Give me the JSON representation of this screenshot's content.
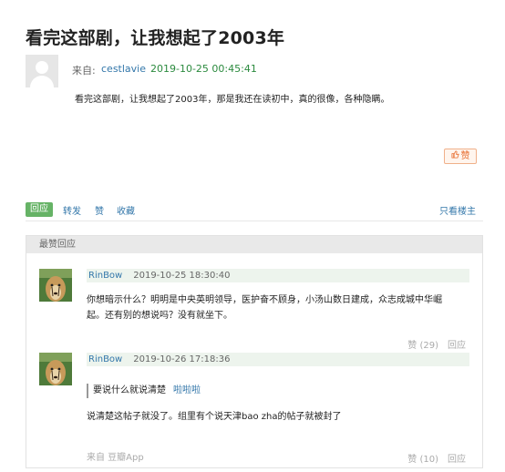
{
  "post": {
    "title": "看完这部剧，让我想起了2003年",
    "from_label": "来自:",
    "author": "cestlavie",
    "time": "2019-10-25 00:45:41",
    "body": "看完这部剧，让我想起了2003年，那是我还在读初中，真的很像，各种隐瞒。",
    "like_label": "赞"
  },
  "actions": {
    "reply": "回应",
    "share": "转发",
    "like": "赞",
    "collect": "收藏",
    "only_op": "只看楼主"
  },
  "comments": {
    "header": "最赞回应",
    "items": [
      {
        "author": "RinBow",
        "time": "2019-10-25 18:30:40",
        "text_line1": "你想暗示什么？明明是中央英明领导，医护奋不顾身，小汤山数日建成，众志成城中华崛",
        "text_line2": "起。还有别的想说吗？没有就坐下。",
        "likes": "赞 (29)",
        "reply": "回应"
      },
      {
        "author": "RinBow",
        "time": "2019-10-26 17:18:36",
        "quote_text": "要说什么就说清楚",
        "quote_author": "啦啦啦",
        "text": "说清楚这帖子就没了。组里有个说天津bao zha的帖子就被封了",
        "source": "来自 豆瓣App",
        "likes": "赞 (10)",
        "reply": "回应"
      }
    ]
  },
  "colors": {
    "link": "#3377aa",
    "time_green": "#2b8a3e",
    "reply_button": "#66b366",
    "like_orange": "#e76d2f"
  }
}
